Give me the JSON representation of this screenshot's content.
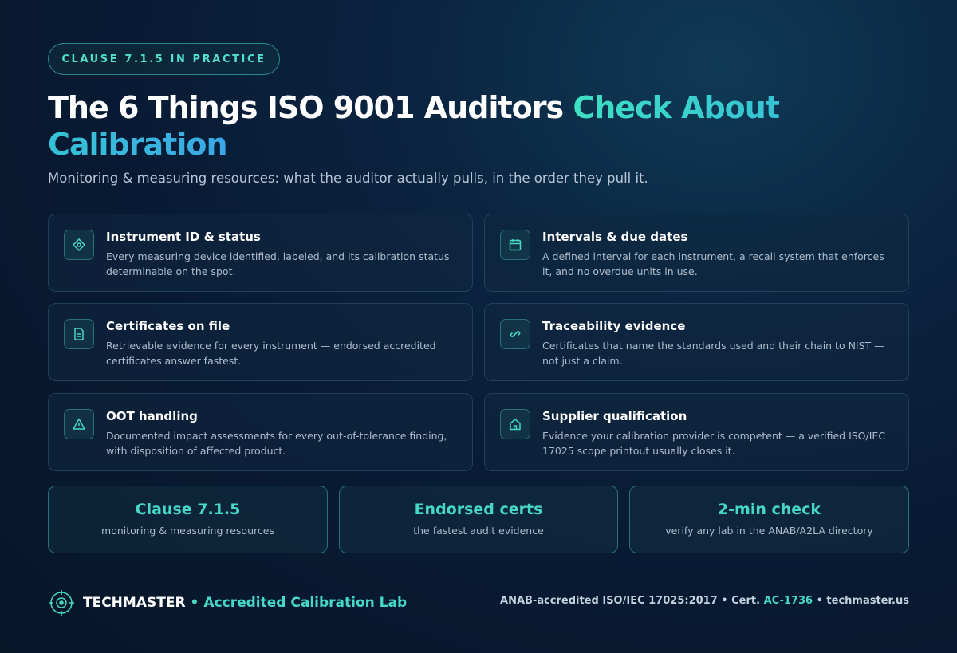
{
  "badge": "CLAUSE 7.1.5 IN PRACTICE",
  "title": {
    "part1": "The 6 Things ISO 9001 Auditors ",
    "part2": "Check About Calibration"
  },
  "subtitle": "Monitoring & measuring resources: what the auditor actually pulls, in the order they pull it.",
  "cards": [
    {
      "icon": "tag-icon",
      "title": "Instrument ID & status",
      "desc": "Every measuring device identified, labeled, and its calibration status determinable on the spot."
    },
    {
      "icon": "calendar-icon",
      "title": "Intervals & due dates",
      "desc": "A defined interval for each instrument, a recall system that enforces it, and no overdue units in use."
    },
    {
      "icon": "document-icon",
      "title": "Certificates on file",
      "desc": "Retrievable evidence for every instrument — endorsed accredited certificates answer fastest."
    },
    {
      "icon": "link-icon",
      "title": "Traceability evidence",
      "desc": "Certificates that name the standards used and their chain to NIST — not just a claim."
    },
    {
      "icon": "warning-icon",
      "title": "OOT handling",
      "desc": "Documented impact assessments for every out-of-tolerance finding, with disposition of affected product."
    },
    {
      "icon": "building-icon",
      "title": "Supplier qualification",
      "desc": "Evidence your calibration provider is competent — a verified ISO/IEC 17025 scope printout usually closes it."
    }
  ],
  "stats": [
    {
      "value": "Clause 7.1.5",
      "label": "monitoring & measuring resources"
    },
    {
      "value": "Endorsed certs",
      "label": "the fastest audit evidence"
    },
    {
      "value": "2-min check",
      "label": "verify any lab in the ANAB/A2LA directory"
    }
  ],
  "footer": {
    "brand": "TECHMASTER",
    "separator": "•",
    "tagline": "Accredited Calibration Lab",
    "accreditation": "ANAB-accredited ISO/IEC 17025:2017 • Cert. ",
    "cert": "AC-1736",
    "site_prefix": " • ",
    "site": "techmaster.us"
  },
  "colors": {
    "accent": "#46d8c4",
    "background": "#081a33",
    "card_border": "#23405a"
  }
}
